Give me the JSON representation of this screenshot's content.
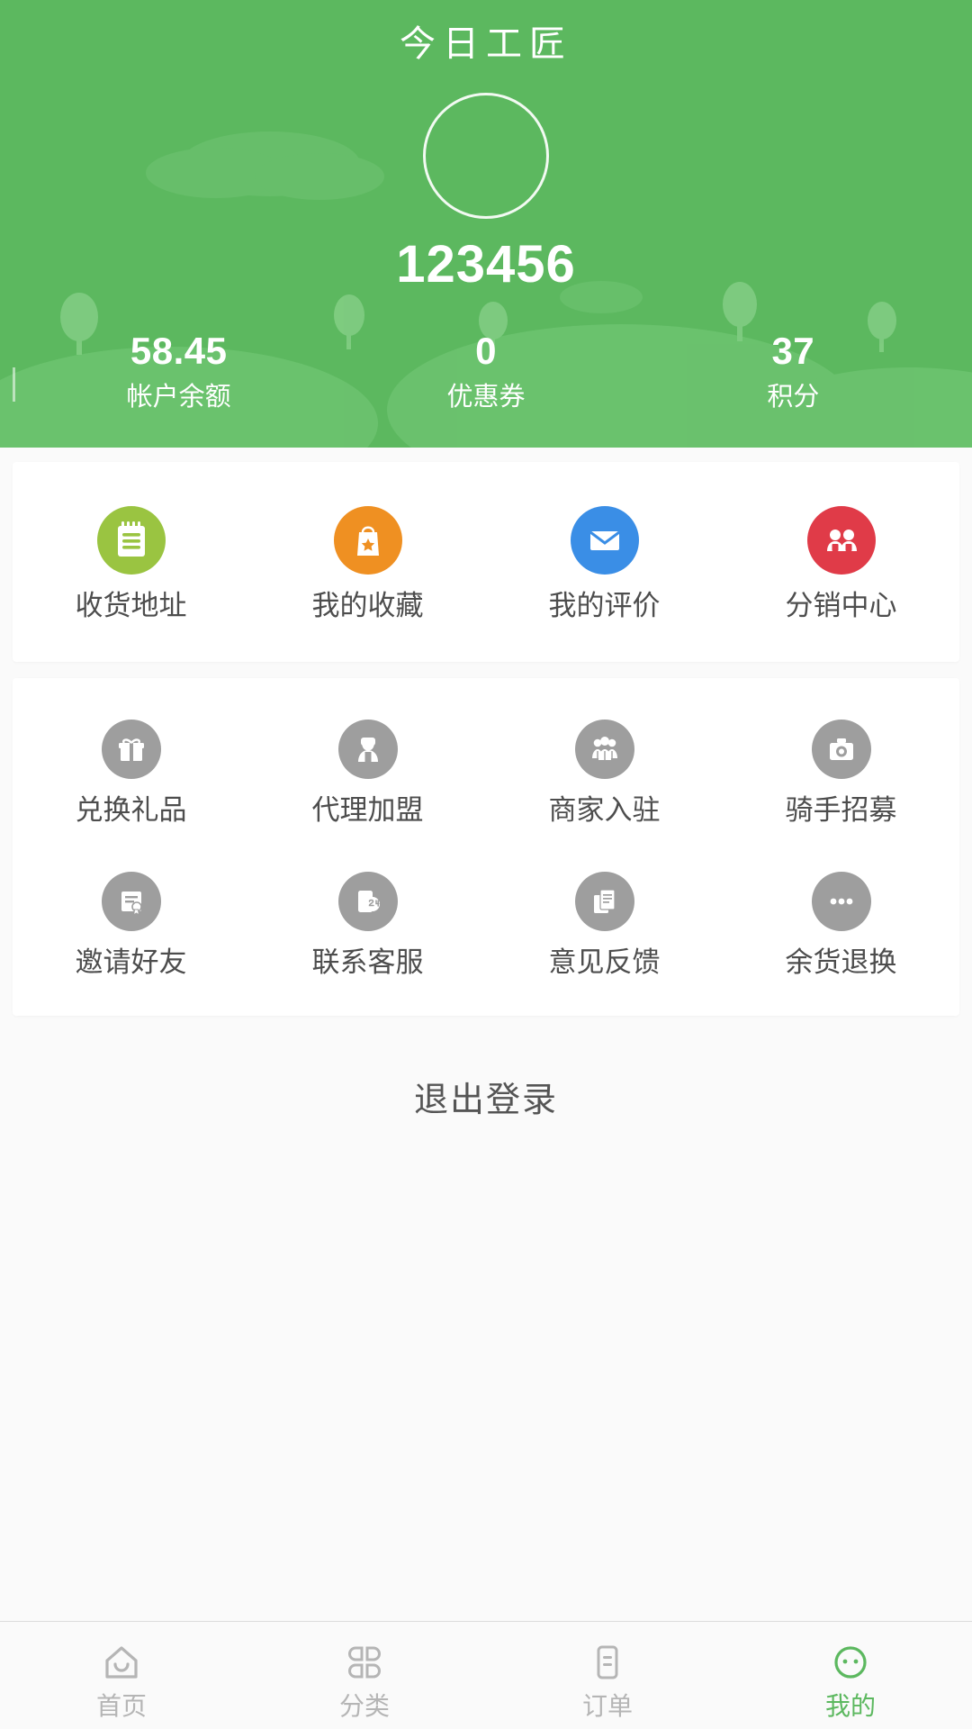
{
  "header": {
    "title": "今日工匠",
    "avatar_icon": "avatar-placeholder-circle",
    "nickname": "123456",
    "stats": [
      {
        "value": "58.45",
        "label": "帐户余额"
      },
      {
        "value": "0",
        "label": "优惠券"
      },
      {
        "value": "37",
        "label": "积分"
      }
    ],
    "background_color": "#5cb85f",
    "text_color": "#ffffff"
  },
  "menu_primary": [
    {
      "label": "收货地址",
      "icon": "clipboard-list-icon",
      "color": "#9ac441"
    },
    {
      "label": "我的收藏",
      "icon": "shopping-bag-star-icon",
      "color": "#ef9022"
    },
    {
      "label": "我的评价",
      "icon": "envelope-icon",
      "color": "#3a8ee6"
    },
    {
      "label": "分销中心",
      "icon": "two-people-icon",
      "color": "#e03b48"
    }
  ],
  "menu_secondary": [
    {
      "label": "兑换礼品",
      "icon": "gift-box-icon",
      "color": "#9e9e9e"
    },
    {
      "label": "代理加盟",
      "icon": "person-badge-icon",
      "color": "#9e9e9e"
    },
    {
      "label": "商家入驻",
      "icon": "group-people-icon",
      "color": "#9e9e9e"
    },
    {
      "label": "骑手招募",
      "icon": "camera-icon",
      "color": "#9e9e9e"
    },
    {
      "label": "邀请好友",
      "icon": "certificate-icon",
      "color": "#9e9e9e"
    },
    {
      "label": "联系客服",
      "icon": "phone-24h-support-icon",
      "color": "#9e9e9e"
    },
    {
      "label": "意见反馈",
      "icon": "documents-icon",
      "color": "#9e9e9e"
    },
    {
      "label": "余货退换",
      "icon": "ellipsis-icon",
      "color": "#9e9e9e"
    }
  ],
  "logout": {
    "label": "退出登录"
  },
  "tabbar": {
    "active_color": "#5cb85f",
    "inactive_color": "#b5b5b5",
    "items": [
      {
        "label": "首页",
        "icon": "home-icon",
        "active": false
      },
      {
        "label": "分类",
        "icon": "grid-categories-icon",
        "active": false
      },
      {
        "label": "订单",
        "icon": "order-list-icon",
        "active": false
      },
      {
        "label": "我的",
        "icon": "smiley-face-icon",
        "active": true
      }
    ]
  }
}
